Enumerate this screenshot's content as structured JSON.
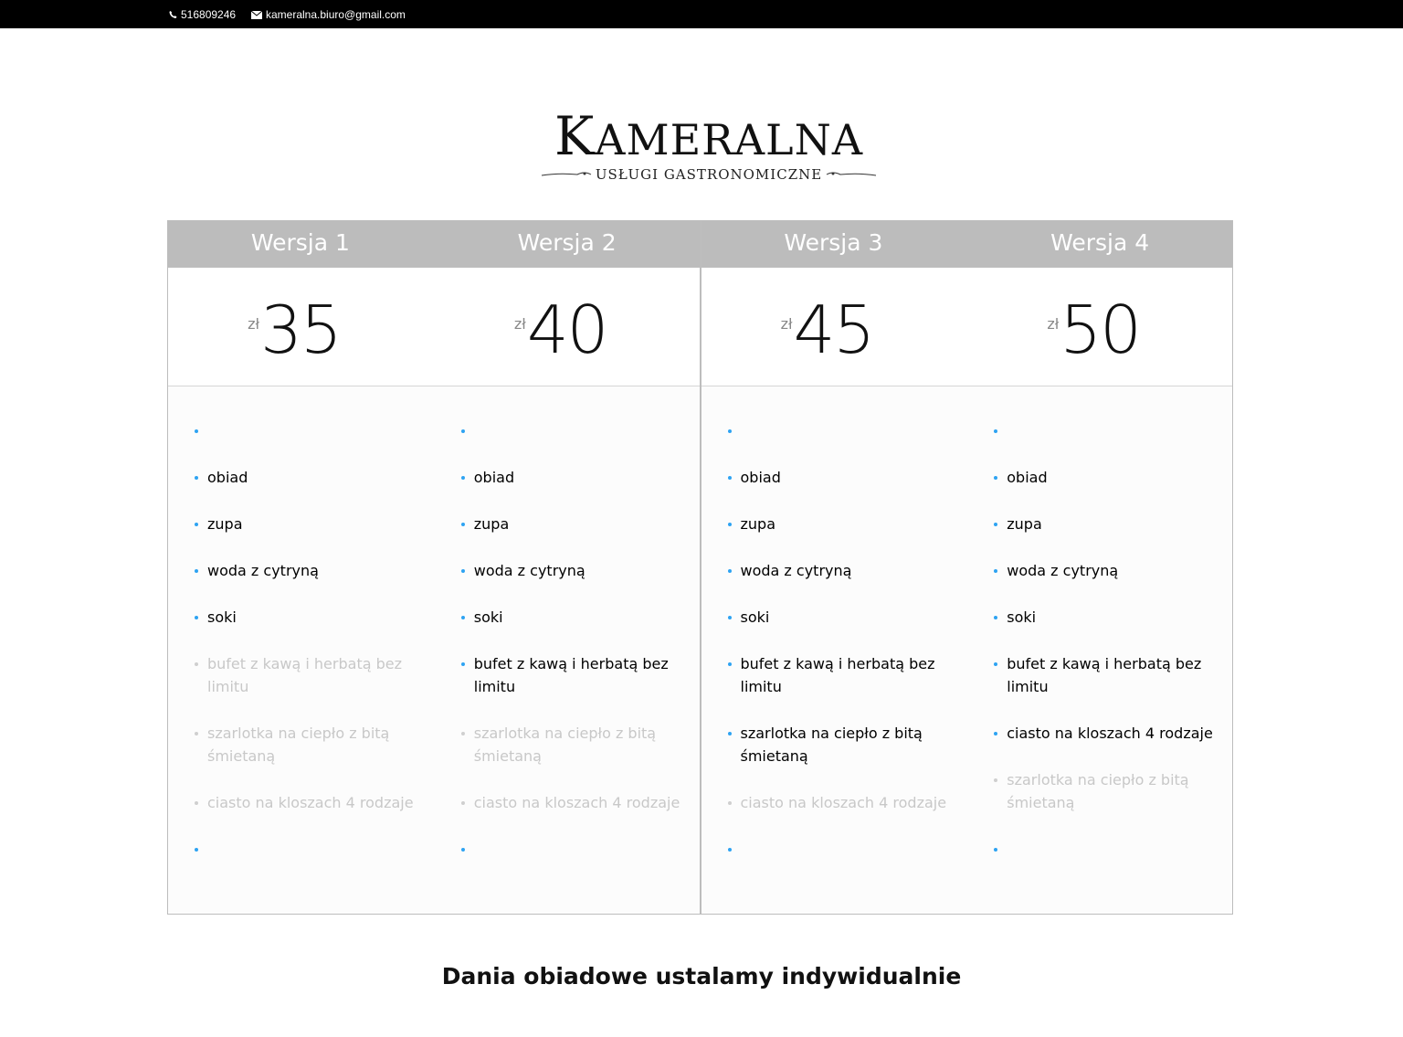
{
  "topbar": {
    "phone": "516809246",
    "email": "kameralna.biuro@gmail.com"
  },
  "logo": {
    "brand_first": "K",
    "brand_rest": "AMERALNA",
    "tagline": "USŁUGI GASTRONOMICZNE"
  },
  "currency": "zł",
  "plans": [
    {
      "title": "Wersja 1",
      "price": "35",
      "features": [
        {
          "text": "",
          "included": true
        },
        {
          "text": "obiad",
          "included": true
        },
        {
          "text": "zupa",
          "included": true
        },
        {
          "text": "woda z cytryną",
          "included": true
        },
        {
          "text": "soki",
          "included": true
        },
        {
          "text": "bufet z kawą i herbatą bez limitu",
          "included": false
        },
        {
          "text": "szarlotka na ciepło z bitą śmietaną",
          "included": false
        },
        {
          "text": "ciasto na kloszach 4 rodzaje",
          "included": false
        },
        {
          "text": "",
          "included": true
        }
      ]
    },
    {
      "title": "Wersja 2",
      "price": "40",
      "features": [
        {
          "text": "",
          "included": true
        },
        {
          "text": "obiad",
          "included": true
        },
        {
          "text": "zupa",
          "included": true
        },
        {
          "text": "woda z cytryną",
          "included": true
        },
        {
          "text": "soki",
          "included": true
        },
        {
          "text": "bufet z kawą i herbatą bez limitu",
          "included": true
        },
        {
          "text": "szarlotka na ciepło z bitą śmietaną",
          "included": false
        },
        {
          "text": "ciasto na kloszach 4 rodzaje",
          "included": false
        },
        {
          "text": "",
          "included": true
        }
      ]
    },
    {
      "title": "Wersja 3",
      "price": "45",
      "features": [
        {
          "text": "",
          "included": true
        },
        {
          "text": "obiad",
          "included": true
        },
        {
          "text": "zupa",
          "included": true
        },
        {
          "text": "woda z cytryną",
          "included": true
        },
        {
          "text": "soki",
          "included": true
        },
        {
          "text": "bufet z kawą i herbatą bez limitu",
          "included": true
        },
        {
          "text": "szarlotka na ciepło z bitą śmietaną",
          "included": true
        },
        {
          "text": "ciasto na kloszach 4 rodzaje",
          "included": false
        },
        {
          "text": "",
          "included": true
        }
      ]
    },
    {
      "title": "Wersja 4",
      "price": "50",
      "features": [
        {
          "text": "",
          "included": true
        },
        {
          "text": "obiad",
          "included": true
        },
        {
          "text": "zupa",
          "included": true
        },
        {
          "text": "woda z cytryną",
          "included": true
        },
        {
          "text": "soki",
          "included": true
        },
        {
          "text": "bufet z kawą i herbatą bez limitu",
          "included": true
        },
        {
          "text": "ciasto na kloszach 4 rodzaje",
          "included": true
        },
        {
          "text": "szarlotka na ciepło z bitą śmietaną",
          "included": false
        },
        {
          "text": "",
          "included": true
        }
      ]
    }
  ],
  "footer_note": "Dania obiadowe ustalamy indywidualnie",
  "colors": {
    "topbar_bg": "#000000",
    "header_bg": "#bcbcbc",
    "bullet": "#2ea3f2",
    "excluded_text": "#c8c8c8"
  },
  "icons": {
    "phone": "phone-icon",
    "email": "envelope-icon"
  }
}
